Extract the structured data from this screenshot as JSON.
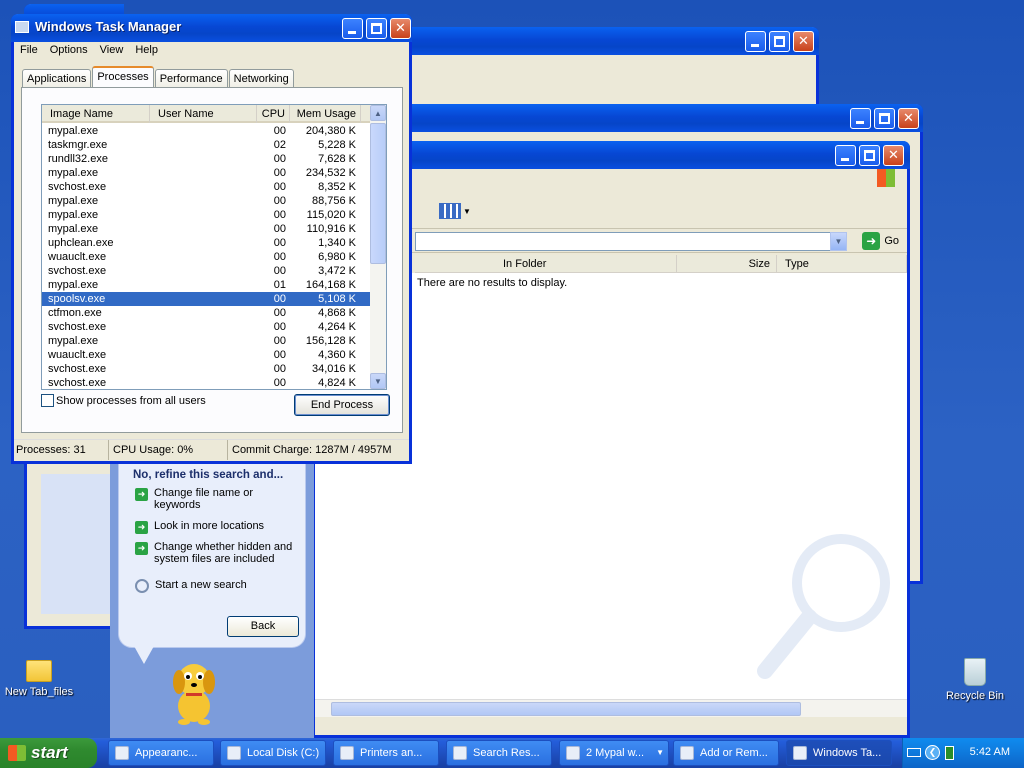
{
  "desktop": {
    "icons": [
      {
        "label": "New Tab_files"
      },
      {
        "label": "Recycle Bin"
      }
    ]
  },
  "search_window": {
    "address_go": "Go",
    "columns": [
      "In Folder",
      "Size",
      "Type"
    ],
    "empty_message": "There are no results to display.",
    "companion": {
      "heading": "No, refine this search and...",
      "options": [
        "Change file name or keywords",
        "Look in more locations",
        "Change whether hidden and system files are included"
      ],
      "new_search": "Start a new search",
      "back": "Back"
    }
  },
  "task_manager": {
    "title": "Windows Task Manager",
    "menu": [
      "File",
      "Options",
      "View",
      "Help"
    ],
    "tabs": [
      "Applications",
      "Processes",
      "Performance",
      "Networking"
    ],
    "active_tab": "Processes",
    "columns": [
      "Image Name",
      "User Name",
      "CPU",
      "Mem Usage"
    ],
    "processes": [
      {
        "name": "mypal.exe",
        "user": "",
        "cpu": "00",
        "mem": "204,380 K"
      },
      {
        "name": "taskmgr.exe",
        "user": "",
        "cpu": "02",
        "mem": "5,228 K"
      },
      {
        "name": "rundll32.exe",
        "user": "",
        "cpu": "00",
        "mem": "7,628 K"
      },
      {
        "name": "mypal.exe",
        "user": "",
        "cpu": "00",
        "mem": "234,532 K"
      },
      {
        "name": "svchost.exe",
        "user": "",
        "cpu": "00",
        "mem": "8,352 K"
      },
      {
        "name": "mypal.exe",
        "user": "",
        "cpu": "00",
        "mem": "88,756 K"
      },
      {
        "name": "mypal.exe",
        "user": "",
        "cpu": "00",
        "mem": "115,020 K"
      },
      {
        "name": "mypal.exe",
        "user": "",
        "cpu": "00",
        "mem": "110,916 K"
      },
      {
        "name": "uphclean.exe",
        "user": "",
        "cpu": "00",
        "mem": "1,340 K"
      },
      {
        "name": "wuauclt.exe",
        "user": "",
        "cpu": "00",
        "mem": "6,980 K"
      },
      {
        "name": "svchost.exe",
        "user": "",
        "cpu": "00",
        "mem": "3,472 K"
      },
      {
        "name": "mypal.exe",
        "user": "",
        "cpu": "01",
        "mem": "164,168 K"
      },
      {
        "name": "spoolsv.exe",
        "user": "",
        "cpu": "00",
        "mem": "5,108 K",
        "selected": true
      },
      {
        "name": "ctfmon.exe",
        "user": "",
        "cpu": "00",
        "mem": "4,868 K"
      },
      {
        "name": "svchost.exe",
        "user": "",
        "cpu": "00",
        "mem": "4,264 K"
      },
      {
        "name": "mypal.exe",
        "user": "",
        "cpu": "00",
        "mem": "156,128 K"
      },
      {
        "name": "wuauclt.exe",
        "user": "",
        "cpu": "00",
        "mem": "4,360 K"
      },
      {
        "name": "svchost.exe",
        "user": "",
        "cpu": "00",
        "mem": "34,016 K"
      },
      {
        "name": "svchost.exe",
        "user": "",
        "cpu": "00",
        "mem": "4,824 K"
      }
    ],
    "show_all_label": "Show processes from all users",
    "show_all_checked": false,
    "end_process": "End Process",
    "status": {
      "processes": "Processes: 31",
      "cpu": "CPU Usage: 0%",
      "commit": "Commit Charge: 1287M / 4957M"
    }
  },
  "taskbar": {
    "start": "start",
    "buttons": [
      {
        "label": "Appearanc..."
      },
      {
        "label": "Local Disk (C:)"
      },
      {
        "label": "Printers an..."
      },
      {
        "label": "Search Res..."
      },
      {
        "label": "2 Mypal w..."
      },
      {
        "label": "Add or Rem..."
      },
      {
        "label": "Windows Ta...",
        "active": true
      }
    ],
    "clock": "5:42 AM"
  }
}
